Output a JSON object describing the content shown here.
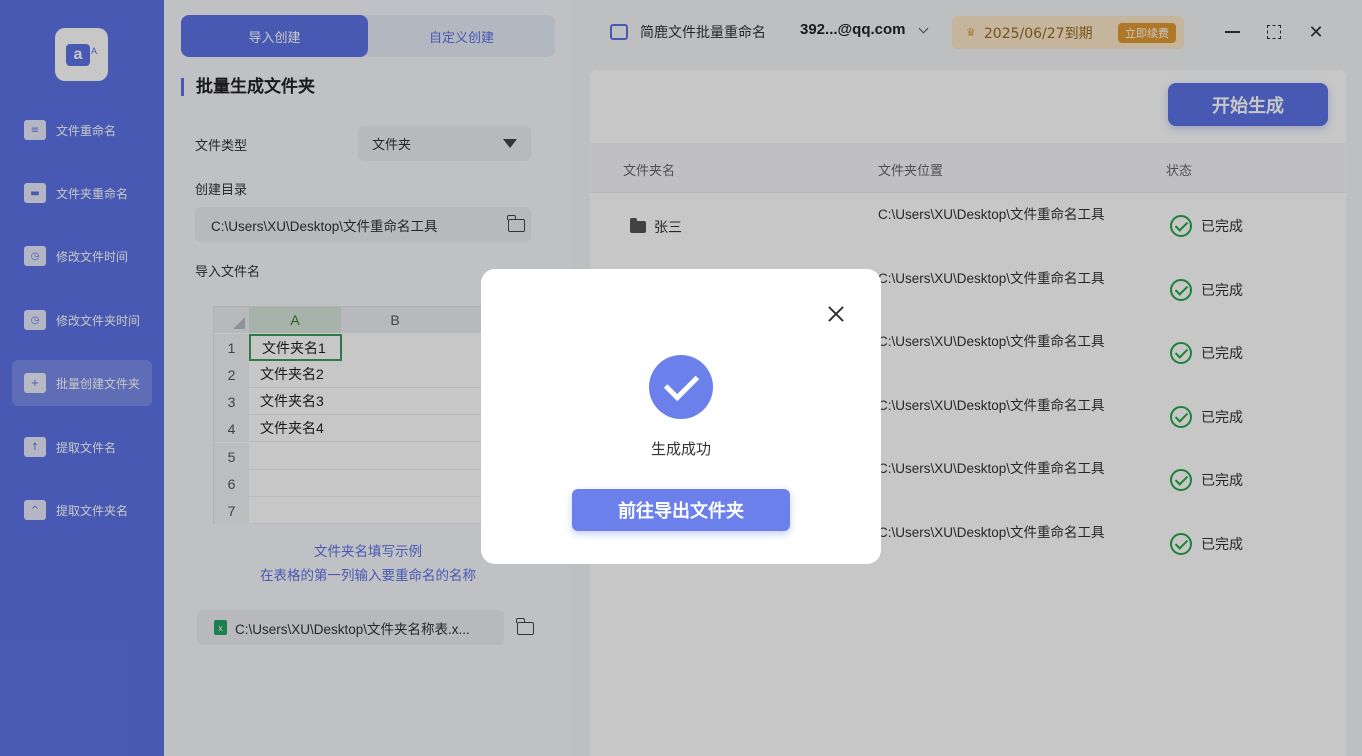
{
  "sidebar": {
    "items": [
      {
        "label": "文件重命名",
        "icon": "file-icon"
      },
      {
        "label": "文件夹重命名",
        "icon": "folder-icon"
      },
      {
        "label": "修改文件时间",
        "icon": "file-clock-icon"
      },
      {
        "label": "修改文件夹时间",
        "icon": "folder-clock-icon"
      },
      {
        "label": "批量创建文件夹",
        "icon": "folder-add-icon"
      },
      {
        "label": "提取文件名",
        "icon": "file-upload-icon"
      },
      {
        "label": "提取文件夹名",
        "icon": "folder-upload-icon"
      }
    ]
  },
  "tabs": {
    "import": "导入创建",
    "custom": "自定义创建"
  },
  "form": {
    "section_title": "批量生成文件夹",
    "file_type_label": "文件类型",
    "file_type_value": "文件夹",
    "dir_label": "创建目录",
    "dir_value": "C:\\Users\\XU\\Desktop\\文件重命名工具",
    "import_label": "导入文件名",
    "hint_line1": "文件夹名填写示例",
    "hint_line2": "在表格的第一列输入要重命名的名称",
    "file_value": "C:\\Users\\XU\\Desktop\\文件夹名称表.x..."
  },
  "sheet": {
    "columns": [
      "A",
      "B"
    ],
    "rows": [
      "1",
      "2",
      "3",
      "4",
      "5",
      "6",
      "7"
    ],
    "cells": [
      "文件夹名1",
      "文件夹名2",
      "文件夹名3",
      "文件夹名4",
      "",
      "",
      ""
    ]
  },
  "header": {
    "app_name": "简鹿文件批量重命名",
    "account": "392...@qq.com",
    "vip_text": "2025/06/27到期",
    "renew": "立即续费"
  },
  "main": {
    "start_button": "开始生成",
    "columns": {
      "name": "文件夹名",
      "location": "文件夹位置",
      "status": "状态"
    },
    "rows": [
      {
        "name": "张三",
        "path": "C:\\Users\\XU\\Desktop\\文件重命名工具",
        "status": "已完成"
      },
      {
        "name": "",
        "path": "C:\\Users\\XU\\Desktop\\文件重命名工具",
        "status": "已完成"
      },
      {
        "name": "",
        "path": "C:\\Users\\XU\\Desktop\\文件重命名工具",
        "status": "已完成"
      },
      {
        "name": "",
        "path": "C:\\Users\\XU\\Desktop\\文件重命名工具",
        "status": "已完成"
      },
      {
        "name": "",
        "path": "C:\\Users\\XU\\Desktop\\文件重命名工具",
        "status": "已完成"
      },
      {
        "name": "",
        "path": "C:\\Users\\XU\\Desktop\\文件重命名工具",
        "status": "已完成"
      }
    ]
  },
  "modal": {
    "message": "生成成功",
    "button": "前往导出文件夹"
  },
  "colors": {
    "accent": "#5d73e6",
    "success": "#27a644",
    "vip_bg": "#fbe8c8"
  }
}
